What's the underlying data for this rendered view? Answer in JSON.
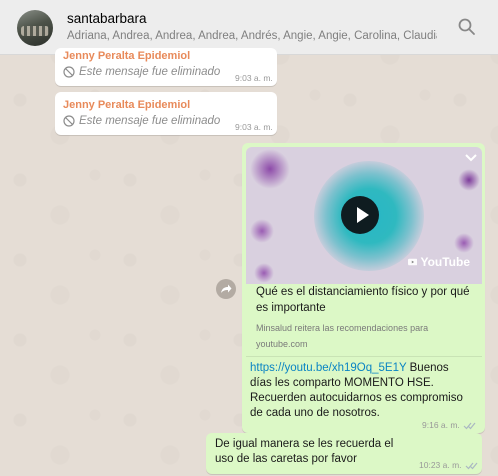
{
  "header": {
    "group_name": "santabarbara",
    "members": "Adriana, Andrea, Andrea, Andrea, Andrés, Angie, Angie, Carolina, Claudia, ...",
    "search_icon": "search-icon"
  },
  "messages": [
    {
      "sender": "Jenny Peralta Epidemiol",
      "text": "Este mensaje fue eliminado",
      "time": "9:03 a. m.",
      "icon": "blocked-icon"
    },
    {
      "sender": "Jenny Peralta Epidemiol",
      "text": "Este mensaje fue eliminado",
      "time": "9:03 a. m.",
      "icon": "blocked-icon"
    }
  ],
  "shared_video": {
    "badge": "YouTube",
    "title": "Qué es el distanciamiento físico y por qué es importante",
    "description": "Minsalud reitera las recomendaciones para",
    "domain": "youtube.com",
    "url": "https://youtu.be/xh19Oq_5E1Y",
    "message": "Buenos días les comparto MOMENTO HSE. Recuerden autocuidarnos es compromiso de cada uno de nosotros.",
    "time": "9:16 a. m."
  },
  "last_message": {
    "text": "De igual manera se les recuerda el uso de las caretas por favor",
    "time": "10:23 a. m."
  },
  "colors": {
    "chat_bg": "#e5ddd5",
    "outgoing_bubble": "#dcf8c6",
    "sender_name": "#e88a5a",
    "link": "#0a84c4",
    "read_ticks": "#4fc3f7"
  }
}
